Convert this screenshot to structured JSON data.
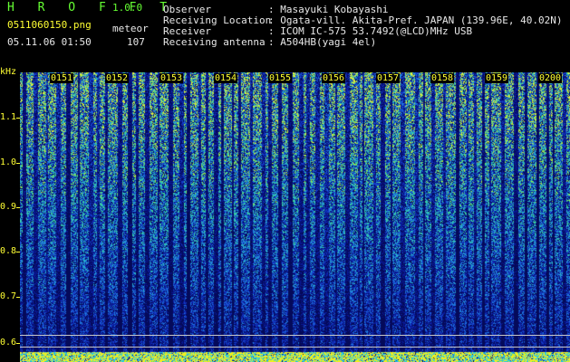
{
  "header": {
    "app_name": "H R O F F T",
    "version": "1.0.0",
    "filename": "0511060150.png",
    "mode": "meteor",
    "datetime": "05.11.06 01:50",
    "count": "107"
  },
  "info": {
    "labels": [
      "Observer",
      "Receiving Location",
      "Receiver",
      "Receiving antenna"
    ],
    "values": [
      ": Masayuki Kobayashi",
      ": Ogata-vill. Akita-Pref. JAPAN (139.96E, 40.02N)",
      ": ICOM IC-575 53.7492(@LCD)MHz USB",
      ": A504HB(yagi 4el)"
    ]
  },
  "y_axis": {
    "unit": "kHz",
    "ticks": [
      "1.1",
      "1.0",
      "0.9",
      "0.8",
      "0.7",
      "0.6"
    ]
  },
  "time_labels": [
    "0151",
    "0152",
    "0153",
    "0154",
    "0155",
    "0156",
    "0157",
    "0158",
    "0159",
    "0200"
  ],
  "colors": {
    "header_green": "#66ff33",
    "label_yellow": "#ffff33",
    "background": "#000000",
    "spectrum_low": "#0a1a8c",
    "spectrum_mid": "#1f7fd8",
    "spectrum_high": "#38c8b0",
    "spectrum_peak": "#ccee33"
  }
}
